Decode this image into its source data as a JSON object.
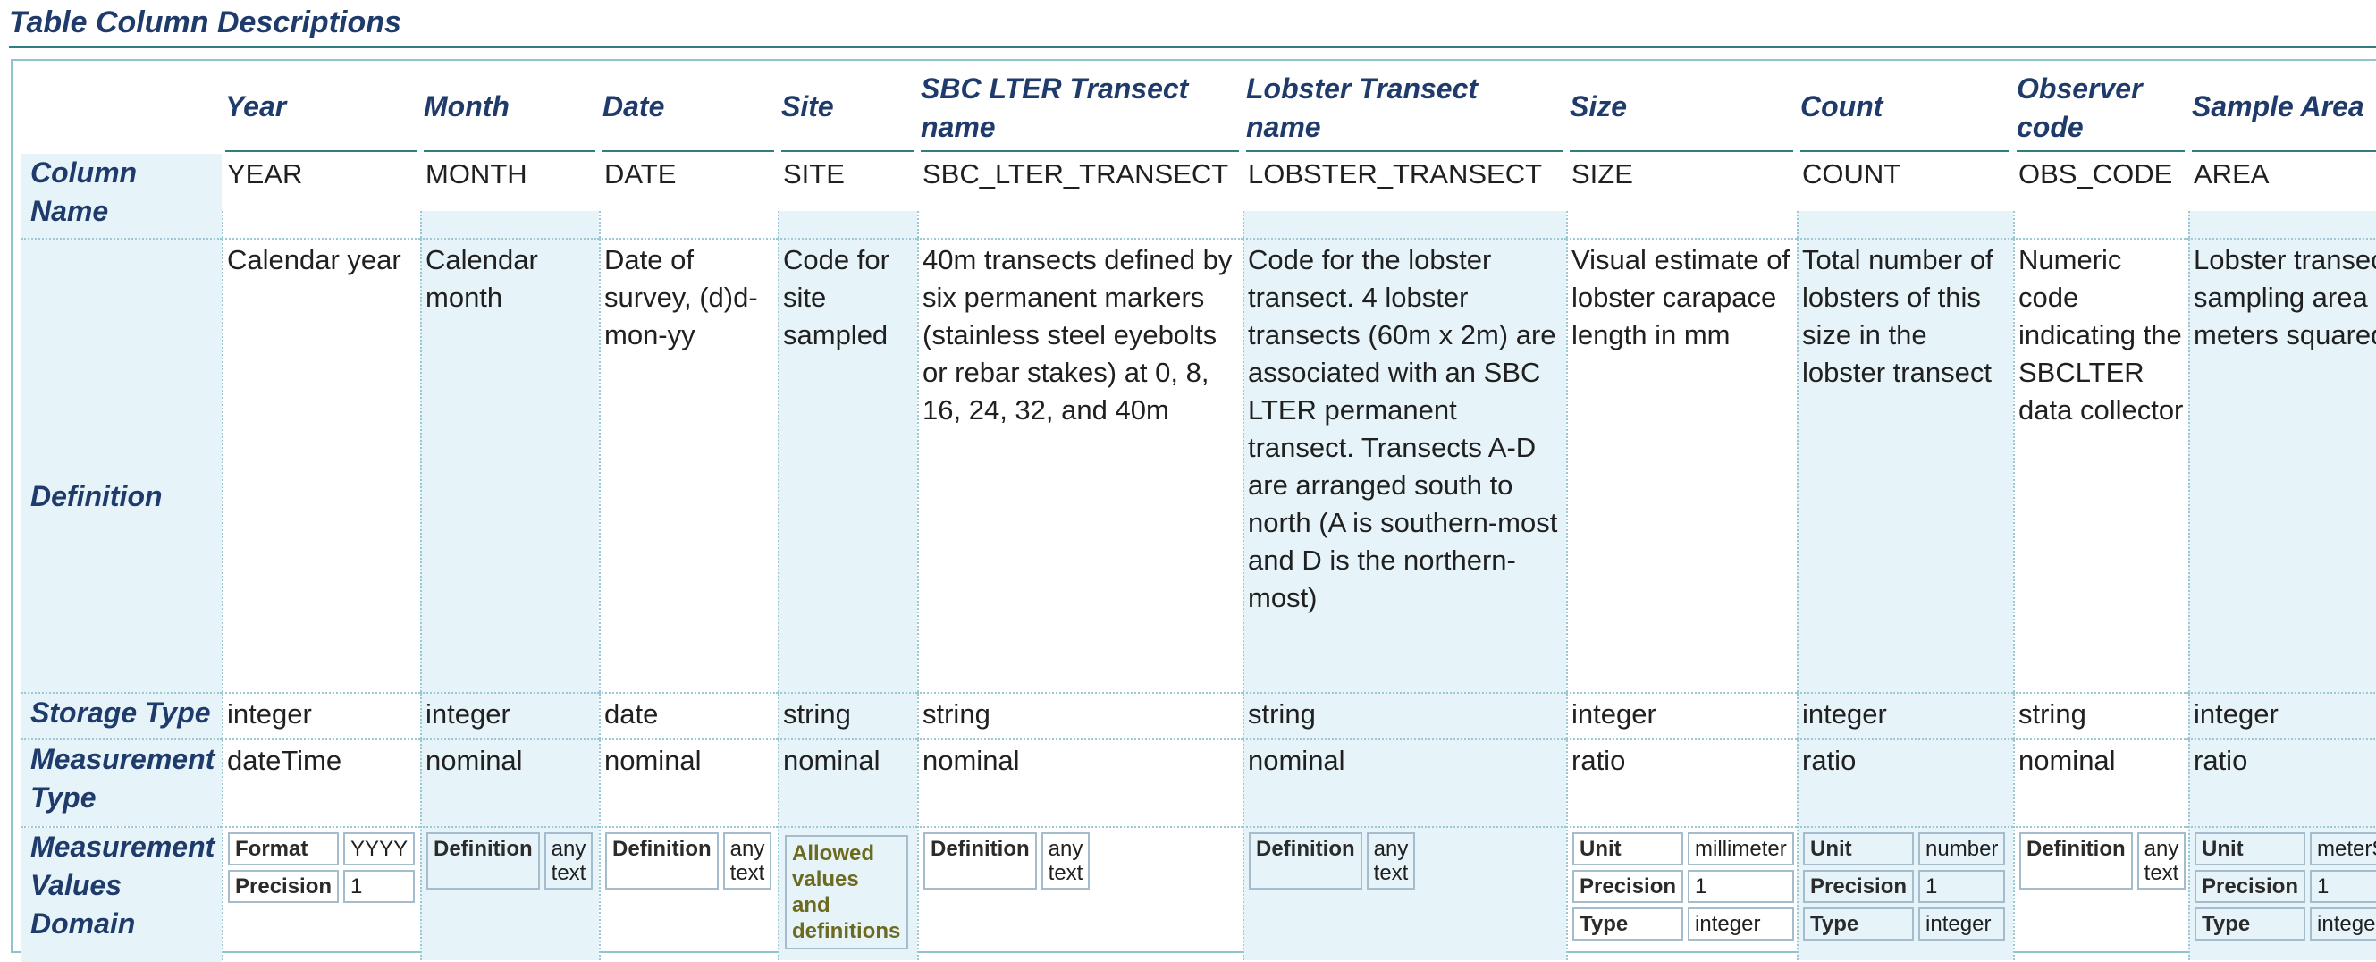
{
  "page": {
    "title": "Table Column Descriptions"
  },
  "row_labels": {
    "column_name": [
      "Column",
      "Name"
    ],
    "definition": [
      "Definition"
    ],
    "storage_type": [
      "Storage Type"
    ],
    "measurement_type": [
      "Measurement",
      "Type"
    ],
    "measurement_values_domain": [
      "Measurement",
      "Values",
      "Domain"
    ]
  },
  "columns": [
    {
      "header": [
        "Year"
      ],
      "name": "YEAR",
      "definition": "Calendar year",
      "storage": "integer",
      "mtype": "dateTime",
      "domain": [
        {
          "k": "Format",
          "v": "YYYY"
        },
        {
          "k": "Precision",
          "v": "1"
        }
      ]
    },
    {
      "header": [
        "Month"
      ],
      "name": "MONTH",
      "definition": "Calendar month",
      "storage": "integer",
      "mtype": "nominal",
      "domain": [
        {
          "k": "Definition",
          "v": "any text"
        }
      ]
    },
    {
      "header": [
        "Date"
      ],
      "name": "DATE",
      "definition": "Date of survey, (d)d-mon-yy",
      "storage": "date",
      "mtype": "nominal",
      "domain": [
        {
          "k": "Definition",
          "v": "any text"
        }
      ]
    },
    {
      "header": [
        "Site"
      ],
      "name": "SITE",
      "definition": "Code for site sampled",
      "storage": "string",
      "mtype": "nominal",
      "allowed": "Allowed values and definitions"
    },
    {
      "header": [
        "SBC LTER Transect",
        "name"
      ],
      "name": "SBC_LTER_TRANSECT",
      "definition": "40m transects defined by six permanent markers (stainless steel eyebolts or rebar stakes) at 0, 8, 16, 24, 32, and 40m",
      "storage": "string",
      "mtype": "nominal",
      "domain": [
        {
          "k": "Definition",
          "v": "any text"
        }
      ]
    },
    {
      "header": [
        "Lobster Transect",
        "name"
      ],
      "name": "LOBSTER_TRANSECT",
      "definition": "Code for the lobster transect. 4 lobster transects (60m x 2m) are associated with an SBC LTER permanent transect. Transects A-D are arranged south to north (A is southern-most and D is the northern-most)",
      "storage": "string",
      "mtype": "nominal",
      "domain": [
        {
          "k": "Definition",
          "v": "any text"
        }
      ]
    },
    {
      "header": [
        "Size"
      ],
      "name": "SIZE",
      "definition": "Visual estimate of lobster carapace length in mm",
      "storage": "integer",
      "mtype": "ratio",
      "domain": [
        {
          "k": "Unit",
          "v": "millimeter"
        },
        {
          "k": "Precision",
          "v": "1"
        },
        {
          "k": "Type",
          "v": "integer"
        }
      ]
    },
    {
      "header": [
        "Count"
      ],
      "name": "COUNT",
      "definition": "Total number of lobsters of this size in the lobster transect",
      "storage": "integer",
      "mtype": "ratio",
      "domain": [
        {
          "k": "Unit",
          "v": "number"
        },
        {
          "k": "Precision",
          "v": "1"
        },
        {
          "k": "Type",
          "v": "integer"
        }
      ]
    },
    {
      "header": [
        "Observer",
        "code"
      ],
      "name": "OBS_CODE",
      "definition": "Numeric code indicating the SBCLTER data collector",
      "storage": "string",
      "mtype": "nominal",
      "domain": [
        {
          "k": "Definition",
          "v": "any text"
        }
      ]
    },
    {
      "header": [
        "Sample Area"
      ],
      "name": "AREA",
      "definition": "Lobster transect sampling area in meters squared",
      "storage": "integer",
      "mtype": "ratio",
      "domain": [
        {
          "k": "Unit",
          "v": "meterSquared"
        },
        {
          "k": "Precision",
          "v": "1"
        },
        {
          "k": "Type",
          "v": "integer"
        }
      ]
    }
  ]
}
